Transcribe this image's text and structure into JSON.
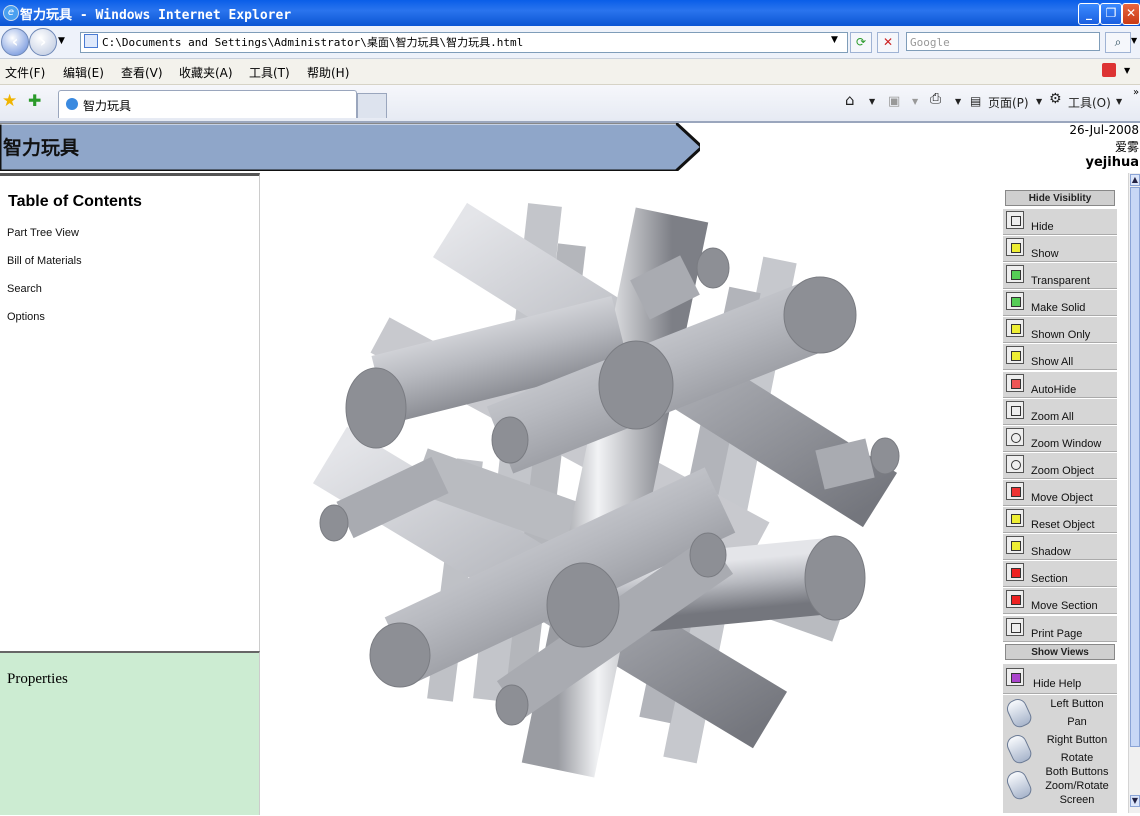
{
  "window": {
    "title": "智力玩具 - Windows Internet Explorer"
  },
  "address_bar": {
    "url": "C:\\Documents and Settings\\Administrator\\桌面\\智力玩具\\智力玩具.html",
    "search_placeholder": "Google"
  },
  "menu": {
    "items": [
      "文件(F)",
      "编辑(E)",
      "查看(V)",
      "收藏夹(A)",
      "工具(T)",
      "帮助(H)"
    ]
  },
  "tabs": {
    "active_label": "智力玩具",
    "page_menu": "页面(P)",
    "tools_menu": "工具(O)"
  },
  "header": {
    "banner": "智力玩具",
    "date": "26-Jul-2008",
    "user1": "爱雾",
    "user2": "yejihua"
  },
  "toc": {
    "title": "Table of Contents",
    "links": [
      "Part Tree View",
      "Bill of Materials",
      "Search",
      "Options"
    ]
  },
  "properties": {
    "title": "Properties"
  },
  "rightbar": {
    "hide_visibility": "Hide Visiblity",
    "show_views": "Show Views",
    "buttons": [
      "Hide",
      "Show",
      "Transparent",
      "Make Solid",
      "Shown Only",
      "Show All",
      "AutoHide",
      "Zoom All",
      "Zoom Window",
      "Zoom Object",
      "Move Object",
      "Reset Object",
      "Shadow",
      "Section",
      "Move Section",
      "Print Page"
    ],
    "hide_help": "Hide Help",
    "help": [
      {
        "line1": "Left Button",
        "line2": "Pan"
      },
      {
        "line1": "Right Button",
        "line2": "Rotate"
      },
      {
        "line1": "Both Buttons",
        "line2": "Zoom/Rotate",
        "line3": "Screen"
      }
    ]
  },
  "colors": {
    "banner": "#8fa6c9",
    "properties_bg": "#ccecd2",
    "title_bar": "#0a5ee8",
    "rod_light": "#d7d9de",
    "rod_dark": "#7b7d84"
  }
}
